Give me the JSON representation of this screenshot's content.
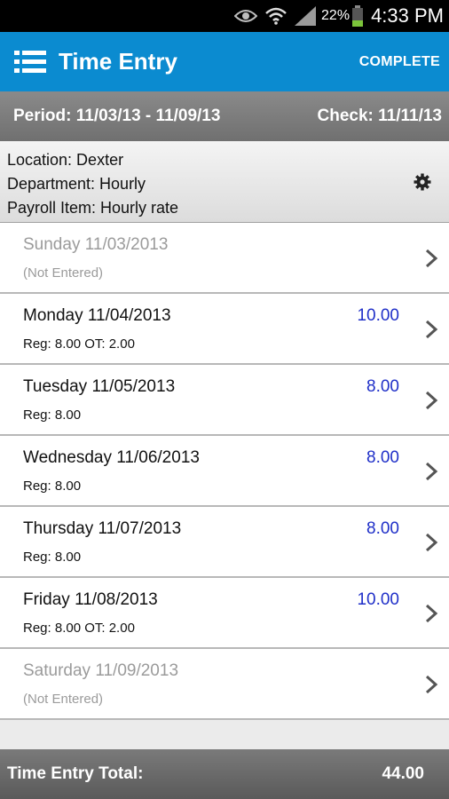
{
  "status_bar": {
    "icons": [
      "eye-icon",
      "wifi-icon",
      "signal-icon",
      "battery-icon"
    ],
    "battery": "22%",
    "time": "4:33 PM"
  },
  "app_bar": {
    "title": "Time Entry",
    "action": "COMPLETE"
  },
  "period_bar": {
    "period": "Period: 11/03/13 - 11/09/13",
    "check": "Check: 11/11/13"
  },
  "info": {
    "location": "Location: Dexter",
    "department": "Department: Hourly",
    "payroll_item": "Payroll Item: Hourly rate"
  },
  "days": [
    {
      "day": "Sunday 11/03/2013",
      "detail": "(Not Entered)",
      "hours": ""
    },
    {
      "day": "Monday 11/04/2013",
      "detail": "Reg: 8.00 OT: 2.00",
      "hours": "10.00"
    },
    {
      "day": "Tuesday 11/05/2013",
      "detail": "Reg: 8.00",
      "hours": "8.00"
    },
    {
      "day": "Wednesday 11/06/2013",
      "detail": "Reg: 8.00",
      "hours": "8.00"
    },
    {
      "day": "Thursday 11/07/2013",
      "detail": "Reg: 8.00",
      "hours": "8.00"
    },
    {
      "day": "Friday 11/08/2013",
      "detail": "Reg: 8.00 OT: 2.00",
      "hours": "10.00"
    },
    {
      "day": "Saturday 11/09/2013",
      "detail": "(Not Entered)",
      "hours": ""
    }
  ],
  "footer": {
    "label": "Time Entry Total:",
    "total": "44.00"
  },
  "colors": {
    "app_bar": "#0b8bd0",
    "hours_text": "#1f2fc8",
    "muted_text": "#9b9b9b"
  }
}
